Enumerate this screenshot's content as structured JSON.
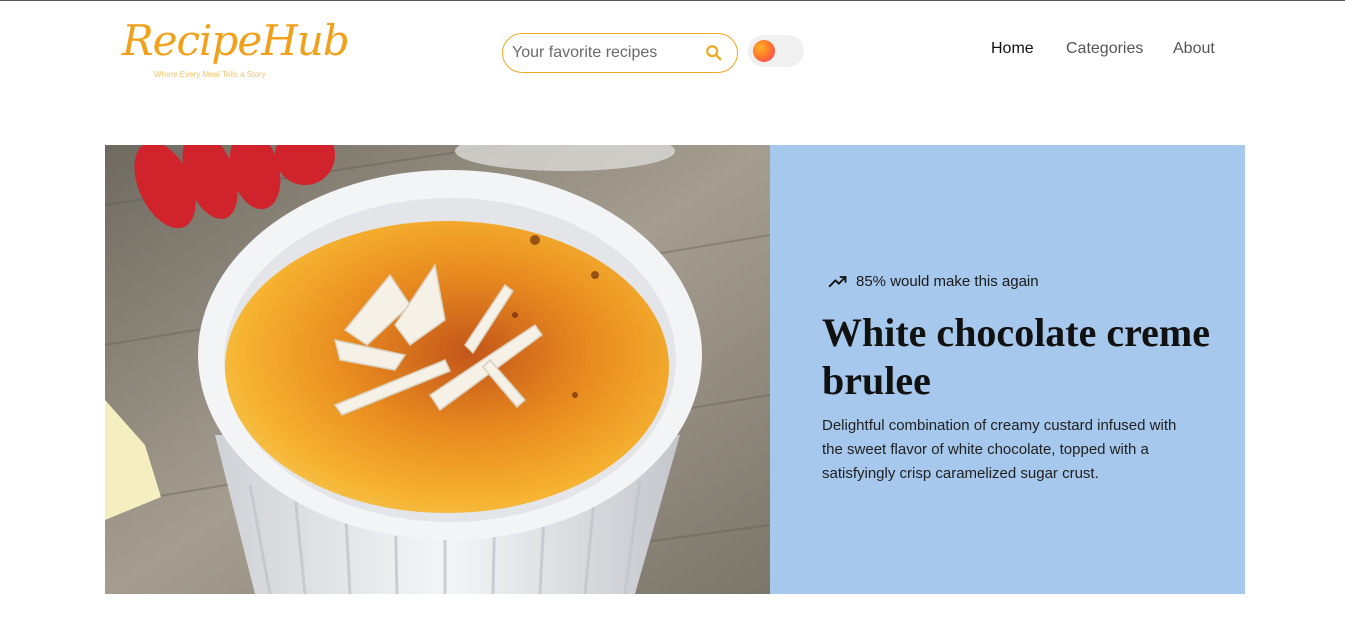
{
  "brand": {
    "name": "RecipeHub",
    "tagline": "Where Every Meal Tells a Story",
    "color": "#f0a01a"
  },
  "search": {
    "placeholder": "Your favorite recipes",
    "value": "",
    "icon": "search-icon"
  },
  "theme_toggle": {
    "state": "off",
    "accent": "#ff7a2a"
  },
  "nav": {
    "items": [
      {
        "label": "Home",
        "active": true
      },
      {
        "label": "Categories",
        "active": false
      },
      {
        "label": "About",
        "active": false
      }
    ]
  },
  "hero": {
    "stat_icon": "trending-up-icon",
    "stat": "85% would make this again",
    "title": "White chocolate creme brulee",
    "description": "Delightful combination of creamy custard infused with the sweet flavor of white chocolate, topped with a satisfyingly crisp caramelized sugar crust.",
    "panel_color": "#a6c8ec",
    "image_alt": "creme-brulee-photo"
  }
}
